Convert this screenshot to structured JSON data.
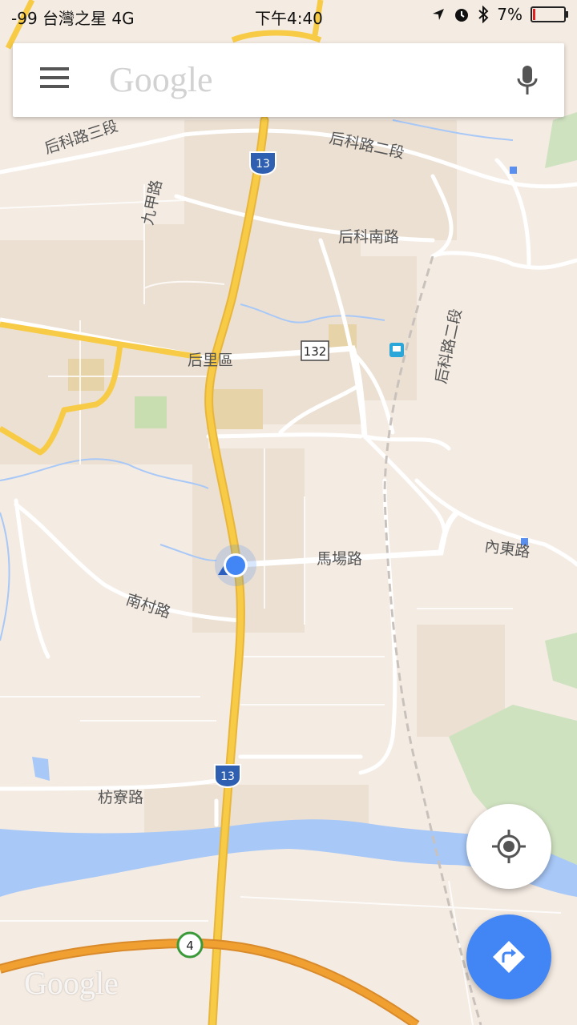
{
  "status_bar": {
    "carrier": "-99 台灣之星 4G",
    "time": "下午4:40",
    "battery": "7%",
    "battery_level": 0.07
  },
  "search": {
    "placeholder": "Google",
    "menu_icon": "hamburger-menu-icon",
    "voice_icon": "microphone-icon"
  },
  "map": {
    "district": "后里區",
    "roads": {
      "houke_3": "后科路三段",
      "houke_2": "后科路二段",
      "houke_2_vertical": "后科路二段",
      "jiujia": "九甲路",
      "houke_south": "后科南路",
      "machang": "馬場路",
      "neidong": "內東路",
      "nancun": "南村路",
      "fangliao": "枋寮路"
    },
    "shields": {
      "freeway_13_top": "13",
      "freeway_13_bottom": "13",
      "route_132": "132",
      "freeway_4": "4"
    }
  },
  "controls": {
    "my_location_icon": "my-location-crosshair-icon",
    "directions_icon": "directions-turn-right-icon"
  },
  "watermark": "Google",
  "colors": {
    "map_background": "#f4ebe2",
    "highway": "#f7cb45",
    "freeway": "#f0a030",
    "river": "#a8c8f8",
    "accent_blue": "#4285f4"
  }
}
